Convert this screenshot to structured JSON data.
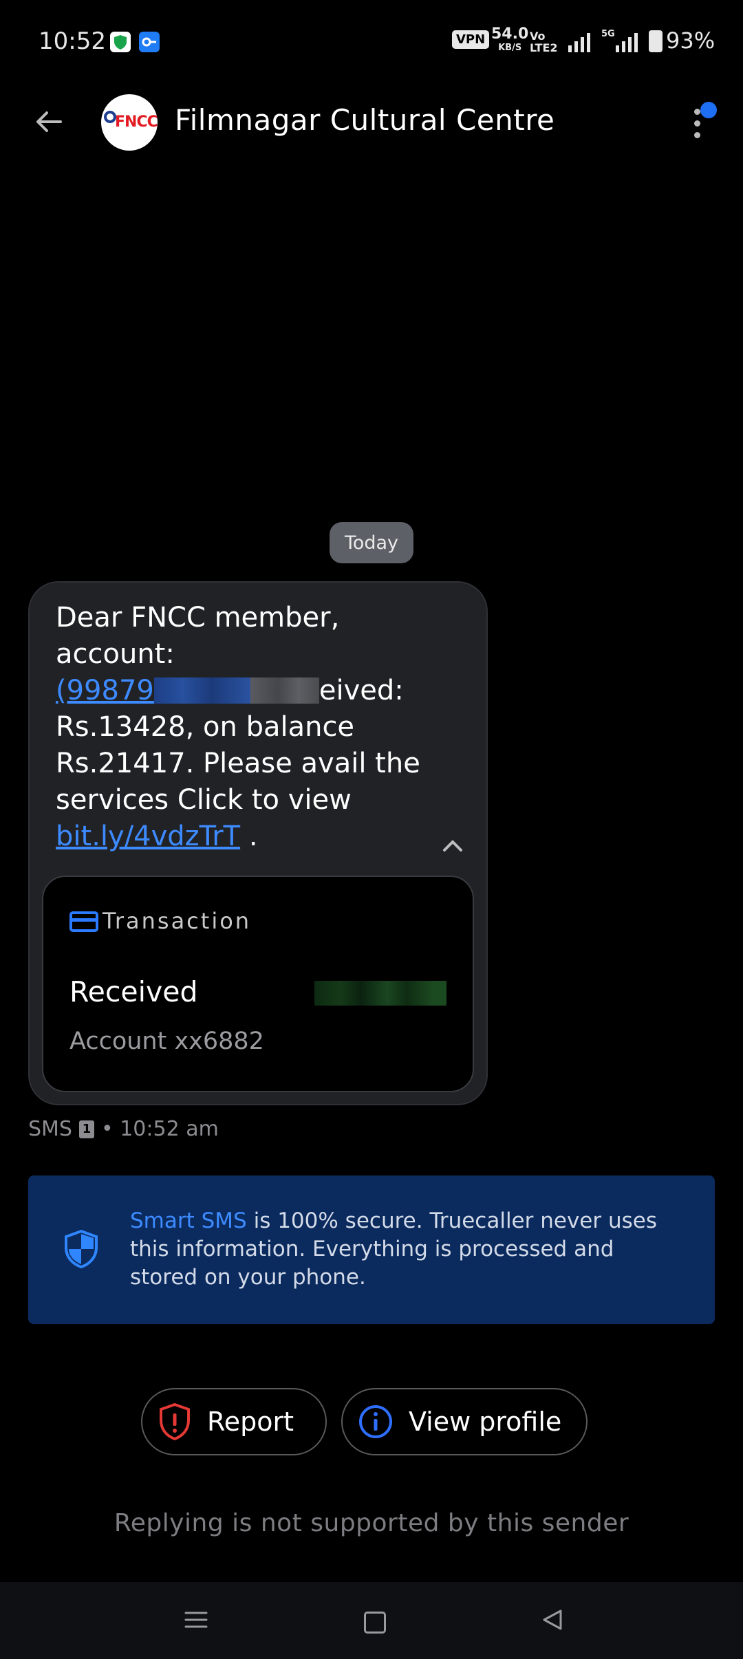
{
  "status_bar": {
    "time": "10:52",
    "vpn_label": "VPN",
    "net_speed": "54.0",
    "net_speed_unit": "KB/S",
    "volte_label": "Vo",
    "lte_label": "LTE2",
    "network_5g": "5G",
    "battery": "93%"
  },
  "header": {
    "contact_name": "Filmnagar Cultural Centre",
    "avatar_text": "FNCC",
    "back_icon": "arrow-left-icon",
    "menu_icon": "more-vert-icon"
  },
  "conversation": {
    "date_chip": "Today",
    "message": {
      "line1": "Dear FNCC member,",
      "line2": "account:",
      "account_link_visible": "(99879",
      "line3_tail": "eived:",
      "line4": "Rs.13428, on balance",
      "line5": "Rs.21417. Please avail the",
      "line6": "services Click to view",
      "url": "bit.ly/4vdzTrT",
      "end": "."
    },
    "smart_card": {
      "label": "Transaction",
      "status": "Received",
      "account": "Account xx6882"
    },
    "meta": {
      "channel": "SMS",
      "sim": "1",
      "time": "• 10:52 am"
    }
  },
  "banner": {
    "highlight": "Smart SMS",
    "text": " is 100% secure. Truecaller never uses this information. Everything is processed and stored on your phone."
  },
  "actions": {
    "report_label": "Report",
    "view_profile_label": "View profile"
  },
  "footer_note": "Replying is not supported by this sender",
  "colors": {
    "accent_blue": "#3d8bff",
    "banner_bg": "#0b2a5e",
    "report_red": "#e53935",
    "bubble_bg": "#212226"
  }
}
